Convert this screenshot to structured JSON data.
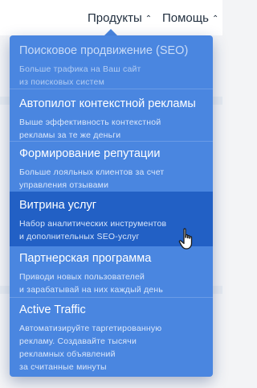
{
  "nav": {
    "products_label": "Продукты",
    "help_label": "Помощь",
    "caret": "⌃"
  },
  "menu": {
    "items": [
      {
        "title": "Поисковое продвижение (SEO)",
        "desc": "Больше трафика на Ваш сайт\nиз поисковых систем",
        "state": "disabled"
      },
      {
        "title": "Автопилот контекстной рекламы",
        "desc": "Выше эффективность контекстной\nрекламы за те же деньги",
        "state": "normal"
      },
      {
        "title": "Формирование репутации",
        "desc": "Больше лояльных клиентов за счет\nуправления отзывами",
        "state": "normal"
      },
      {
        "title": "Витрина услуг",
        "desc": "Набор аналитических инструментов\nи дополнительных SEO-услуг",
        "state": "active"
      },
      {
        "title": "Партнерская программа",
        "desc": "Приводи новых пользователей\nи зарабатывай на них каждый день",
        "state": "normal"
      },
      {
        "title": "Active Traffic",
        "desc": "Автоматизируйте таргетированную\nрекламу. Создавайте тысячи\nрекламных объявлений\nза считанные минуты",
        "state": "normal"
      }
    ]
  },
  "colors": {
    "menu_bg": "#4a86e0",
    "active_bg": "#2260c5",
    "text": "#ffffff",
    "nav_text": "#1f2d3d"
  },
  "icons": {
    "caret": "chevron-up-icon",
    "cursor": "hand-pointer-icon"
  }
}
